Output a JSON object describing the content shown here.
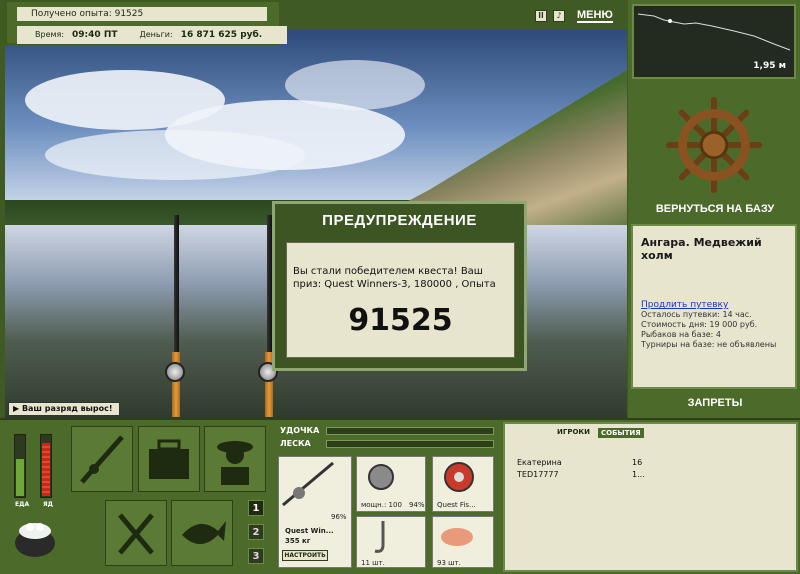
{
  "header": {
    "experience_label": "Получено опыта: 91525",
    "time_label": "Время:",
    "time_value": "09:40 ПТ",
    "money_label": "Деньги:",
    "money_value": "16 871 625 руб.",
    "menu_label": "МЕНЮ",
    "pause_icon": "pause-icon",
    "sound_icon": "sound-icon"
  },
  "depth": {
    "value": "1,95 м"
  },
  "base": {
    "back_label": "ВЕРНУТЬСЯ НА БАЗУ",
    "name": "Ангара. Медвежий холм",
    "extend_link": "Продлить путевку",
    "left": "Осталось путевки: 14 час.",
    "cost": "Стоимость дня: 19 000 руб.",
    "fishers": "Рыбаков на базе: 4",
    "tournaments": "Турниры на базе: не объявлены",
    "bans_label": "ЗАПРЕТЫ"
  },
  "dialog": {
    "title": "ПРЕДУПРЕЖДЕНИЕ",
    "text": "Вы стали победителем квеста! Ваш приз: Quest Winners-3, 180000 , Опыта",
    "number": "91525"
  },
  "rank_text": "Ваш разряд вырос!",
  "needs": {
    "food_label": "ЕДА",
    "poison_label": "ЯД",
    "food_level": 0.6,
    "poison_level": 0.85
  },
  "slots": {
    "num1": "1",
    "num2": "2",
    "num3": "3"
  },
  "tackle": {
    "rod_label": "УДОЧКА",
    "line_label": "ЛЕСКА",
    "rod_name": "Quest Win...",
    "rod_weight": "355 кг",
    "rod_percent": "96%",
    "reel_power": "мощн.: 100",
    "reel_percent": "94%",
    "line_name": "Quest Fis...",
    "hooks_count": "11 шт.",
    "bait_count": "93 шт.",
    "setup_label": "НАСТРОИТЬ"
  },
  "players": {
    "tab_players": "ИГРОКИ",
    "tab_events": "СОБЫТИЯ",
    "rows": [
      {
        "name": "Екатерина",
        "value": "16"
      },
      {
        "name": "TED17777",
        "value": "1..."
      }
    ]
  },
  "colors": {
    "panel": "#4c6a2a",
    "light": "#e8e5cf",
    "link": "#1a35c0"
  }
}
